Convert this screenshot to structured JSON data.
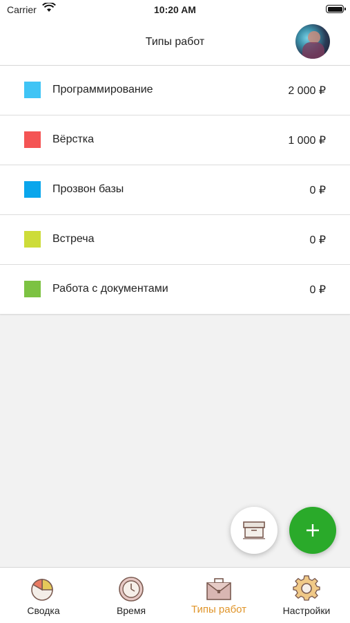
{
  "status_bar": {
    "carrier": "Carrier",
    "time": "10:20 AM"
  },
  "header": {
    "title": "Типы работ"
  },
  "work_types": [
    {
      "label": "Программирование",
      "amount": "2 000 ₽",
      "color": "#40c4f5"
    },
    {
      "label": "Вёрстка",
      "amount": "1 000 ₽",
      "color": "#f45454"
    },
    {
      "label": "Прозвон базы",
      "amount": "0 ₽",
      "color": "#0aa6ec"
    },
    {
      "label": "Встреча",
      "amount": "0 ₽",
      "color": "#cddc39"
    },
    {
      "label": "Работа с документами",
      "amount": "0 ₽",
      "color": "#7cc242"
    }
  ],
  "tabs": [
    {
      "label": "Сводка",
      "icon": "pie-chart-icon"
    },
    {
      "label": "Время",
      "icon": "clock-icon"
    },
    {
      "label": "Типы работ",
      "icon": "briefcase-icon",
      "active": true
    },
    {
      "label": "Настройки",
      "icon": "gear-icon"
    }
  ],
  "colors": {
    "accent_green": "#2aaa2a",
    "active_tab": "#e0952a"
  }
}
